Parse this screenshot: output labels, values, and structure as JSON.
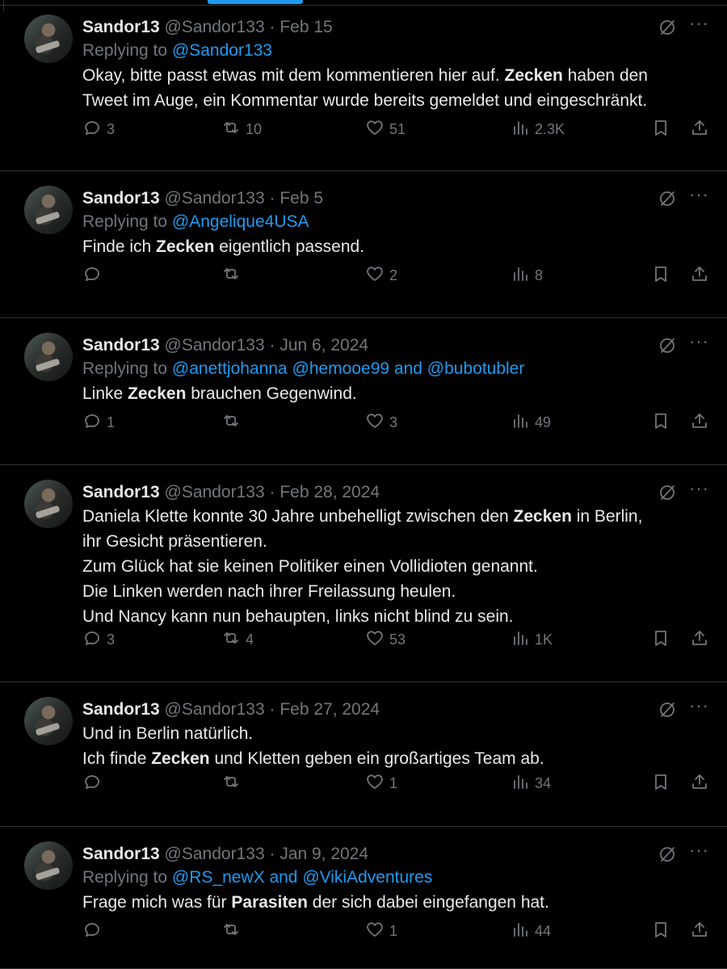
{
  "tweets": [
    {
      "name": "Sandor13",
      "handle": "@Sandor133",
      "sep": "·",
      "date": "Feb 15",
      "replying_prefix": "Replying to ",
      "replying_mentions": "@Sandor133",
      "body_lines": [
        [
          {
            "t": "Okay, bitte passt etwas mit dem kommentieren hier auf. "
          },
          {
            "t": "Zecken",
            "b": true
          },
          {
            "t": " haben den"
          }
        ],
        [
          {
            "t": "Tweet im Auge, ein Kommentar wurde bereits gemeldet und eingeschränkt."
          }
        ]
      ],
      "replies": "3",
      "reposts": "10",
      "likes": "51",
      "views": "2.3K"
    },
    {
      "name": "Sandor13",
      "handle": "@Sandor133",
      "sep": "·",
      "date": "Feb 5",
      "replying_prefix": "Replying to ",
      "replying_mentions": "@Angelique4USA",
      "body_lines": [
        [
          {
            "t": "Finde ich "
          },
          {
            "t": "Zecken",
            "b": true
          },
          {
            "t": " eigentlich passend."
          }
        ]
      ],
      "replies": "",
      "reposts": "",
      "likes": "2",
      "views": "8"
    },
    {
      "name": "Sandor13",
      "handle": "@Sandor133",
      "sep": "·",
      "date": "Jun 6, 2024",
      "replying_prefix": "Replying to ",
      "replying_mentions": "@anettjohanna @hemooe99 and @bubotubler",
      "body_lines": [
        [
          {
            "t": "Linke "
          },
          {
            "t": "Zecken",
            "b": true
          },
          {
            "t": " brauchen Gegenwind."
          }
        ]
      ],
      "replies": "1",
      "reposts": "",
      "likes": "3",
      "views": "49"
    },
    {
      "name": "Sandor13",
      "handle": "@Sandor133",
      "sep": "·",
      "date": "Feb 28, 2024",
      "replying_prefix": "",
      "replying_mentions": "",
      "body_lines": [
        [
          {
            "t": "Daniela Klette konnte 30 Jahre unbehelligt zwischen den "
          },
          {
            "t": "Zecken",
            "b": true
          },
          {
            "t": " in Berlin,"
          }
        ],
        [
          {
            "t": "ihr Gesicht präsentieren."
          }
        ],
        [
          {
            "t": "Zum Glück hat sie keinen Politiker einen Vollidioten genannt."
          }
        ],
        [
          {
            "t": "Die Linken werden nach ihrer Freilassung heulen."
          }
        ],
        [
          {
            "t": "Und Nancy kann nun behaupten, links nicht blind zu sein."
          }
        ]
      ],
      "replies": "3",
      "reposts": "4",
      "likes": "53",
      "views": "1K"
    },
    {
      "name": "Sandor13",
      "handle": "@Sandor133",
      "sep": "·",
      "date": "Feb 27, 2024",
      "replying_prefix": "",
      "replying_mentions": "",
      "body_lines": [
        [
          {
            "t": "Und in Berlin natürlich."
          }
        ],
        [
          {
            "t": "Ich finde "
          },
          {
            "t": "Zecken",
            "b": true
          },
          {
            "t": " und Kletten geben ein großartiges Team ab."
          }
        ]
      ],
      "replies": "",
      "reposts": "",
      "likes": "1",
      "views": "34"
    },
    {
      "name": "Sandor13",
      "handle": "@Sandor133",
      "sep": "·",
      "date": "Jan 9, 2024",
      "replying_prefix": "Replying to ",
      "replying_mentions": "@RS_newX and @VikiAdventures",
      "body_lines": [
        [
          {
            "t": "Frage mich was für "
          },
          {
            "t": "Parasiten",
            "b": true
          },
          {
            "t": " der sich dabei eingefangen hat."
          }
        ]
      ],
      "replies": "",
      "reposts": "",
      "likes": "1",
      "views": "44"
    }
  ],
  "icons": {
    "more": "more-dots-icon",
    "grok": "grok-icon",
    "reply": "reply-icon",
    "repost": "repost-icon",
    "like": "like-icon",
    "views": "views-icon",
    "bookmark": "bookmark-icon",
    "share": "share-icon"
  }
}
